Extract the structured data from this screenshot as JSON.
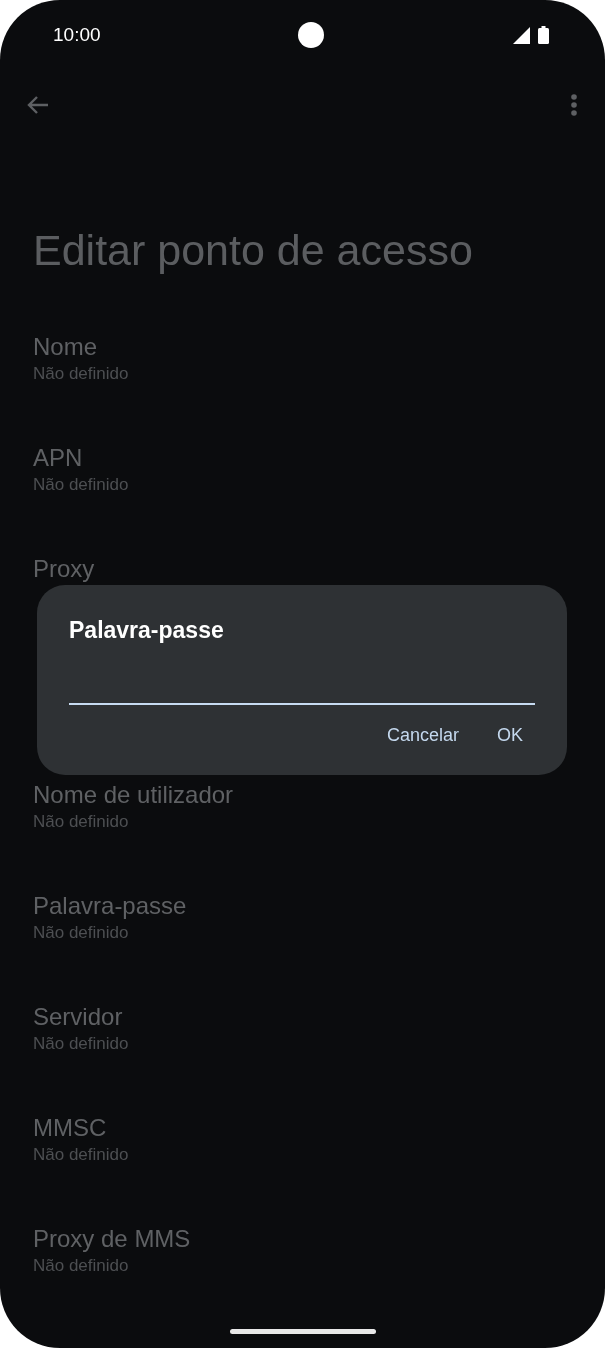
{
  "status_bar": {
    "time": "10:00"
  },
  "page_title": "Editar ponto de acesso",
  "settings": [
    {
      "title": "Nome",
      "summary": "Não definido"
    },
    {
      "title": "APN",
      "summary": "Não definido"
    },
    {
      "title": "Proxy"
    },
    {
      "title": "Nome de utilizador",
      "summary": "Não definido"
    },
    {
      "title": "Palavra-passe",
      "summary": "Não definido"
    },
    {
      "title": "Servidor",
      "summary": "Não definido"
    },
    {
      "title": "MMSC",
      "summary": "Não definido"
    },
    {
      "title": "Proxy de MMS",
      "summary": "Não definido"
    }
  ],
  "dialog": {
    "title": "Palavra-passe",
    "buttons": [
      "Cancelar",
      "OK"
    ]
  }
}
